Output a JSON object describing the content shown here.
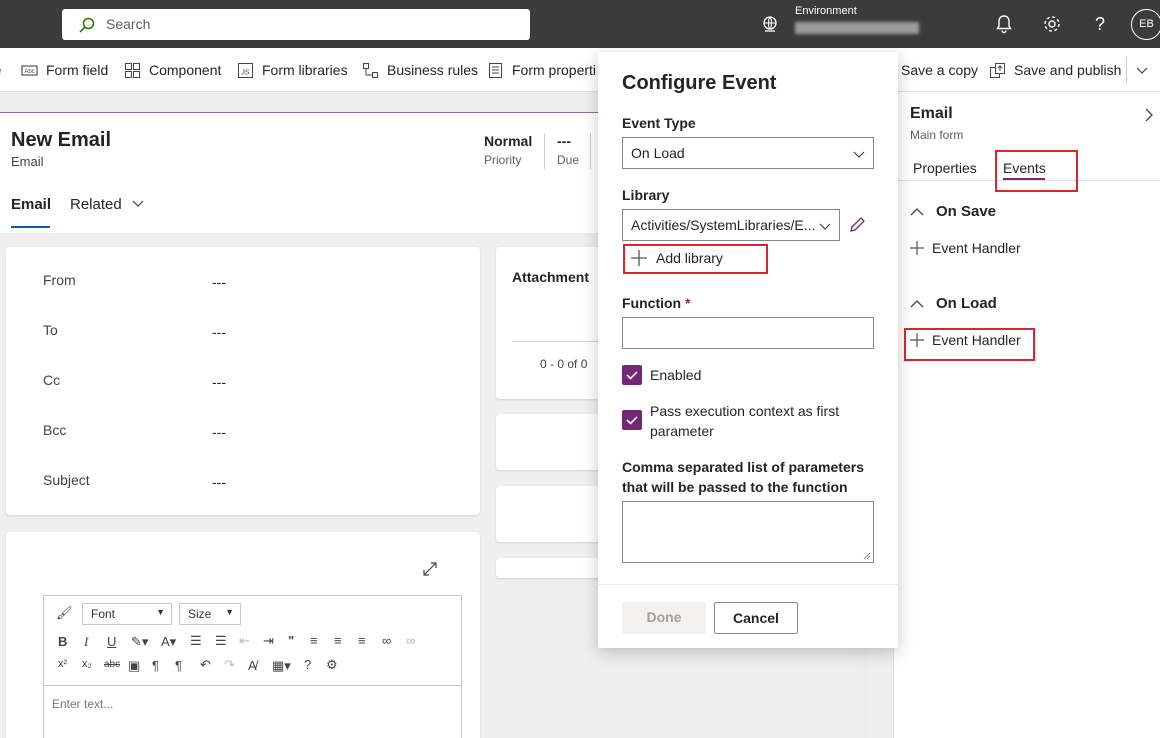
{
  "topbar": {
    "search_placeholder": "Search",
    "environment_label": "Environment",
    "avatar_initials": "EB"
  },
  "commands": {
    "form_field": "Form field",
    "component": "Component",
    "form_libraries": "Form libraries",
    "business_rules": "Business rules",
    "form_properties": "Form properti",
    "save_copy": "Save a copy",
    "save_publish": "Save and publish"
  },
  "form": {
    "title": "New Email",
    "subtitle": "Email",
    "priority_value": "Normal",
    "priority_label": "Priority",
    "due_value": "---",
    "due_label": "Due",
    "tabs": {
      "email": "Email",
      "related": "Related"
    },
    "fields": [
      {
        "label": "From",
        "value": "---"
      },
      {
        "label": "To",
        "value": "---"
      },
      {
        "label": "Cc",
        "value": "---"
      },
      {
        "label": "Bcc",
        "value": "---"
      },
      {
        "label": "Subject",
        "value": "---"
      }
    ],
    "attachment_title": "Attachment",
    "attachment_count": "0 - 0 of 0",
    "editor": {
      "font": "Font",
      "size": "Size",
      "placeholder": "Enter text..."
    }
  },
  "panel": {
    "title": "Email",
    "subtitle": "Main form",
    "tabs": {
      "properties": "Properties",
      "events": "Events"
    },
    "on_save": "On Save",
    "on_load": "On Load",
    "event_handler": "Event Handler"
  },
  "dialog": {
    "title": "Configure Event",
    "event_type_label": "Event Type",
    "event_type_value": "On Load",
    "library_label": "Library",
    "library_value": "Activities/SystemLibraries/E...",
    "add_library": "Add library",
    "function_label": "Function",
    "function_required": "*",
    "function_value": "",
    "enabled_label": "Enabled",
    "pass_context_line1": "Pass execution context as first",
    "pass_context_line2": "parameter",
    "params_label_line1": "Comma separated list of parameters",
    "params_label_line2": "that will be passed to the function",
    "params_value": "",
    "done": "Done",
    "cancel": "Cancel"
  },
  "colors": {
    "accent": "#742774",
    "highlight": "#d8262c",
    "topbar": "#3b3b3b"
  }
}
